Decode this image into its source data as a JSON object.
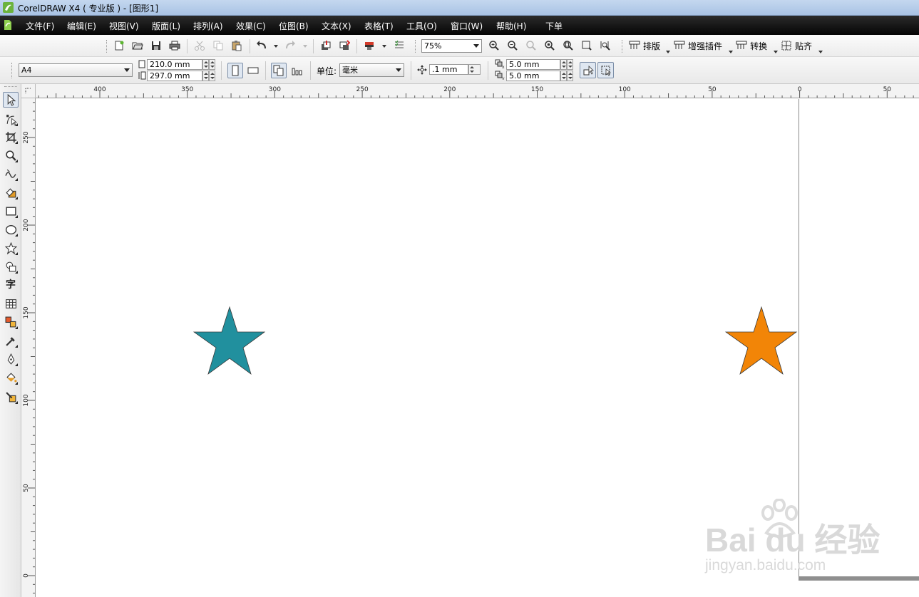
{
  "window": {
    "title": "CorelDRAW X4 ( 专业版 ) - [图形1]"
  },
  "menu": {
    "items": [
      "文件(F)",
      "编辑(E)",
      "视图(V)",
      "版面(L)",
      "排列(A)",
      "效果(C)",
      "位图(B)",
      "文本(X)",
      "表格(T)",
      "工具(O)",
      "窗口(W)",
      "帮助(H)",
      "下单"
    ]
  },
  "toolbar": {
    "zoom": "75%",
    "plugins": [
      "排版",
      "增强插件",
      "转换",
      "贴齐"
    ]
  },
  "property_bar": {
    "paper_size": "A4",
    "width": "210.0 mm",
    "height": "297.0 mm",
    "units_label": "单位:",
    "units_value": "毫米",
    "nudge": ".1 mm",
    "dup_x": "5.0 mm",
    "dup_y": "5.0 mm"
  },
  "rulers": {
    "horizontal_labels": [
      "400",
      "350",
      "300",
      "250",
      "200",
      "150",
      "100",
      "50",
      "0",
      "50"
    ],
    "vertical_labels": [
      "250",
      "200",
      "150",
      "100",
      "50",
      "0"
    ]
  },
  "shapes": {
    "star_left_color": "#21909e",
    "star_right_color": "#f28507"
  },
  "watermark": {
    "logo": "Bai du 经验",
    "url": "jingyan.baidu.com"
  }
}
